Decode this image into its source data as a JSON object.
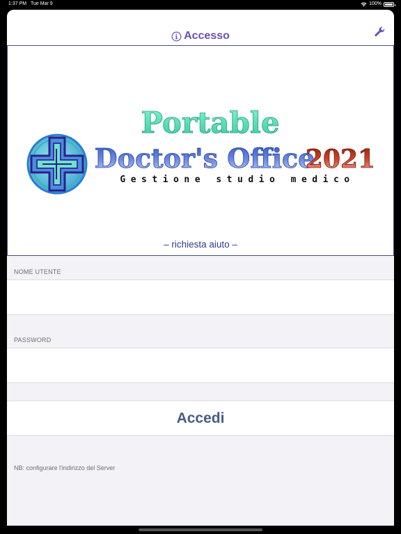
{
  "status_bar": {
    "time": "1:37 PM",
    "date": "Tue Mar 9",
    "battery": "100%"
  },
  "nav": {
    "title": "Accesso",
    "info_icon": "info-circle-icon",
    "settings_icon": "wrench-icon",
    "accent_color": "#6a4fb6"
  },
  "logo": {
    "line1": "Portable",
    "line2": "Doctor's Office",
    "year": "2021",
    "tagline": "Gestione studio medico",
    "emblem": "medical-cross-emblem"
  },
  "help_link": "– richiesta aiuto –",
  "form": {
    "username_label": "NOME UTENTE",
    "username_value": "",
    "password_label": "PASSWORD",
    "password_value": ""
  },
  "login_button": "Accedi",
  "note": "NB: configurare l'indirizzo del Server"
}
